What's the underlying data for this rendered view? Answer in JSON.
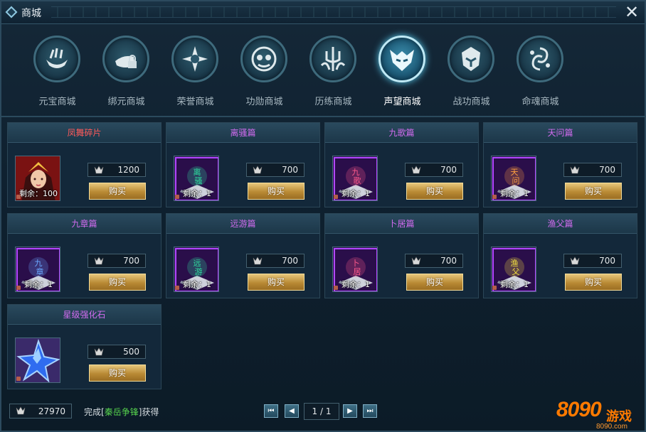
{
  "window": {
    "title": "商城",
    "close_label": "✕"
  },
  "tabs": [
    {
      "label": "元宝商城",
      "icon": "ingot-icon",
      "active": false
    },
    {
      "label": "绑元商城",
      "icon": "locked-ingot-icon",
      "active": false
    },
    {
      "label": "荣誉商城",
      "icon": "star-badge-icon",
      "active": false
    },
    {
      "label": "功勋商城",
      "icon": "merit-mask-icon",
      "active": false
    },
    {
      "label": "历练商城",
      "icon": "trident-icon",
      "active": false
    },
    {
      "label": "声望商城",
      "icon": "demon-mask-icon",
      "active": true
    },
    {
      "label": "战功商城",
      "icon": "war-helm-icon",
      "active": false
    },
    {
      "label": "命魂商城",
      "icon": "soul-swirl-icon",
      "active": false
    }
  ],
  "items": [
    {
      "name": "凤舞碎片",
      "name_color": "#ff5a5a",
      "thumb_text": "",
      "stock": "剩余：100",
      "price": "1200",
      "buy_label": "购买",
      "kind": "portrait"
    },
    {
      "name": "离骚篇",
      "name_color": "#d26cf0",
      "thumb_text": "离骚",
      "stock": "剩余：1",
      "price": "700",
      "buy_label": "购买",
      "kind": "book",
      "glow": "#2ee0a0"
    },
    {
      "name": "九歌篇",
      "name_color": "#d26cf0",
      "thumb_text": "九歌",
      "stock": "剩余：1",
      "price": "700",
      "buy_label": "购买",
      "kind": "book",
      "glow": "#ff5a8c"
    },
    {
      "name": "天问篇",
      "name_color": "#d26cf0",
      "thumb_text": "天问",
      "stock": "剩余：1",
      "price": "700",
      "buy_label": "购买",
      "kind": "book",
      "glow": "#ffa040"
    },
    {
      "name": "九章篇",
      "name_color": "#d26cf0",
      "thumb_text": "九章",
      "stock": "剩余：1",
      "price": "700",
      "buy_label": "购买",
      "kind": "book",
      "glow": "#6aa8ff"
    },
    {
      "name": "远游篇",
      "name_color": "#d26cf0",
      "thumb_text": "远游",
      "stock": "剩余：1",
      "price": "700",
      "buy_label": "购买",
      "kind": "book",
      "glow": "#2ee0a0"
    },
    {
      "name": "卜居篇",
      "name_color": "#d26cf0",
      "thumb_text": "卜居",
      "stock": "剩余：1",
      "price": "700",
      "buy_label": "购买",
      "kind": "book",
      "glow": "#ff5a8c"
    },
    {
      "name": "渔父篇",
      "name_color": "#d26cf0",
      "thumb_text": "渔父",
      "stock": "剩余：1",
      "price": "700",
      "buy_label": "购买",
      "kind": "book",
      "glow": "#f2e040"
    },
    {
      "name": "星级强化石",
      "name_color": "#d26cf0",
      "thumb_text": "",
      "stock": "",
      "price": "500",
      "buy_label": "购买",
      "kind": "star"
    }
  ],
  "footer": {
    "currency": "27970",
    "tip_prefix": "完成[",
    "tip_highlight": "秦岳争锋",
    "tip_suffix": "]获得",
    "page_info": "1 / 1",
    "first_label": "⏮",
    "prev_label": "◀",
    "next_label": "▶",
    "last_label": "⏭"
  },
  "logo": {
    "main": "8090",
    "game": "游戏",
    "site": "8090.com"
  },
  "colors": {
    "accent_gold": "#c89a45",
    "panel": "#13283a",
    "highlight_green": "#55d04d"
  }
}
